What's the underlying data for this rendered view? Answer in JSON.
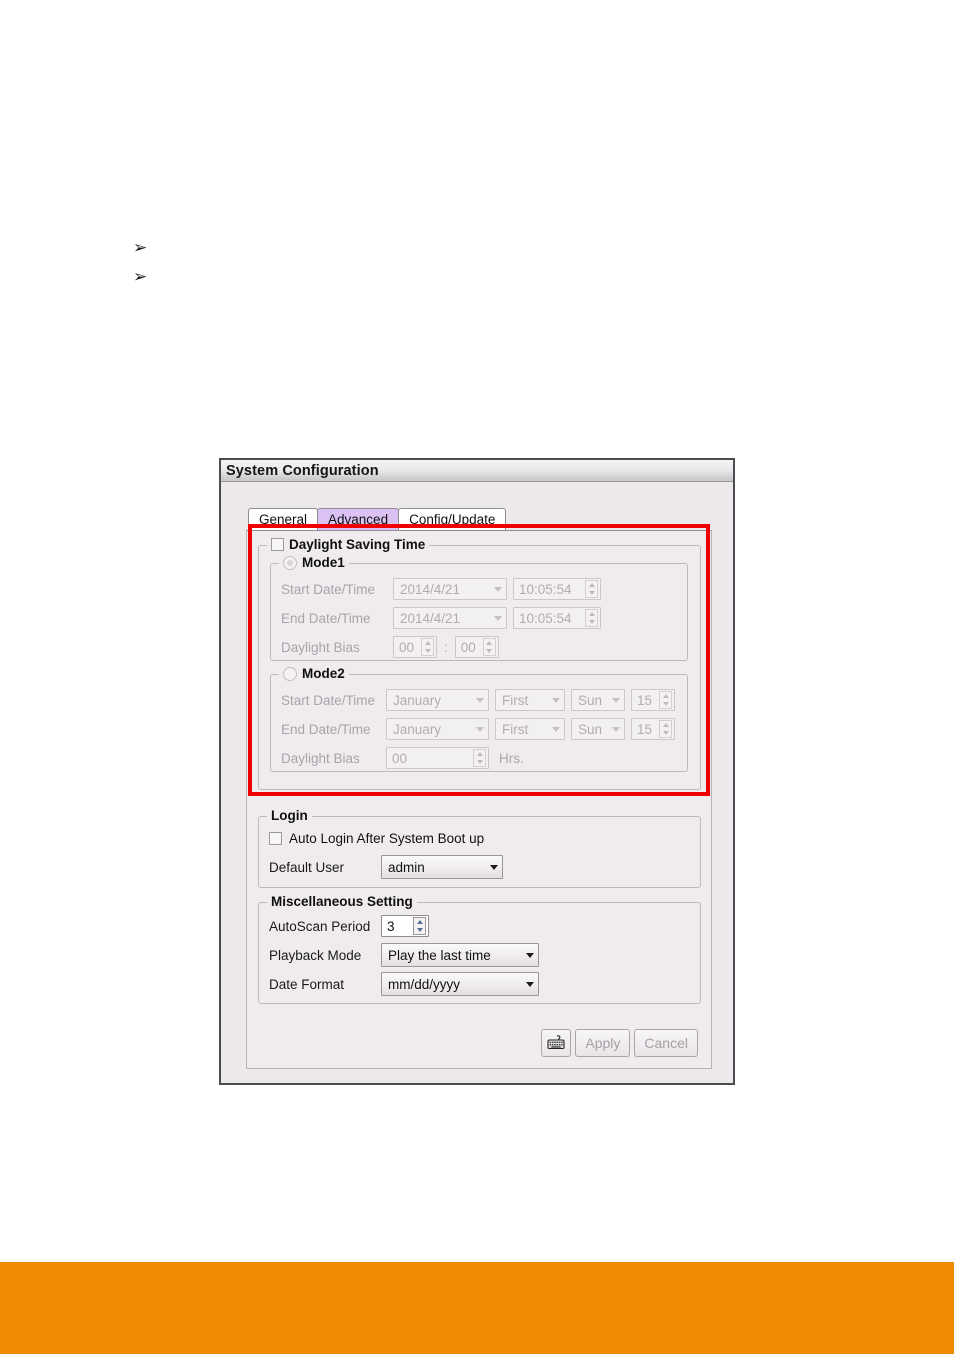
{
  "page": {
    "bullets": [
      "➢",
      "➢"
    ],
    "footer_color": "#f08a00"
  },
  "dialog": {
    "title": "System Configuration",
    "tabs": [
      {
        "label": "General",
        "active": false
      },
      {
        "label": "Advanced",
        "active": true
      },
      {
        "label": "Config/Update",
        "active": false
      }
    ],
    "highlight_color": "#ee0000",
    "daylight": {
      "title": "Daylight Saving Time",
      "checked": false,
      "mode1": {
        "title": "Mode1",
        "selected": true,
        "rows": [
          {
            "label": "Start Date/Time",
            "date": "2014/4/21",
            "time": "10:05:54"
          },
          {
            "label": "End Date/Time",
            "date": "2014/4/21",
            "time": "10:05:54"
          }
        ],
        "bias_label": "Daylight Bias",
        "bias_hours": "00",
        "bias_separator": ":",
        "bias_minutes": "00"
      },
      "mode2": {
        "title": "Mode2",
        "selected": false,
        "rows": [
          {
            "label": "Start Date/Time",
            "month": "January",
            "ordinal": "First",
            "weekday": "Sun",
            "hour": "15"
          },
          {
            "label": "End Date/Time",
            "month": "January",
            "ordinal": "First",
            "weekday": "Sun",
            "hour": "15"
          }
        ],
        "bias_label": "Daylight Bias",
        "bias_value": "00",
        "bias_unit": "Hrs."
      }
    },
    "login": {
      "title": "Login",
      "auto_login_label": "Auto Login After System Boot up",
      "auto_login_checked": false,
      "default_user_label": "Default User",
      "default_user_value": "admin"
    },
    "misc": {
      "title": "Miscellaneous Setting",
      "autoscan_label": "AutoScan Period",
      "autoscan_value": "3",
      "playback_label": "Playback Mode",
      "playback_value": "Play the last time",
      "dateformat_label": "Date Format",
      "dateformat_value": "mm/dd/yyyy"
    },
    "buttons": {
      "keyboard_icon": "virtual-keyboard-icon",
      "apply_label": "Apply",
      "cancel_label": "Cancel"
    }
  }
}
